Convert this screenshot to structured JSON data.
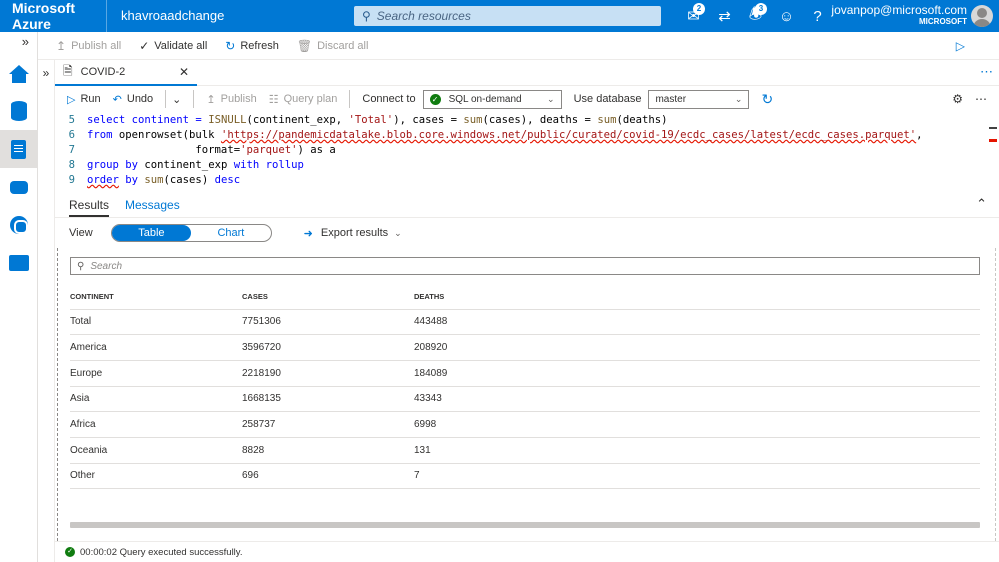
{
  "topbar": {
    "brand": "Microsoft Azure",
    "workspace": "khavroaadchange",
    "search_placeholder": "Search resources",
    "notifications_feedback_count": "2",
    "notifications_count": "3",
    "user_email": "jovanpop@microsoft.com",
    "user_org": "MICROSOFT",
    "accent_color": "#0078d4"
  },
  "commandbar": {
    "publish_all": "Publish all",
    "validate_all": "Validate all",
    "refresh": "Refresh",
    "discard_all": "Discard all"
  },
  "document_tab": {
    "title": "COVID-2"
  },
  "editor_toolbar": {
    "run": "Run",
    "undo": "Undo",
    "publish": "Publish",
    "query_plan": "Query plan",
    "connect_to_label": "Connect to",
    "connect_to_value": "SQL on-demand",
    "use_database_label": "Use database",
    "use_database_value": "master"
  },
  "code": {
    "line_numbers": [
      "5",
      "6",
      "7",
      "8",
      "9"
    ],
    "l5_a": "select continent = ",
    "l5_fn": "ISNULL",
    "l5_b": "(continent_exp, ",
    "l5_str": "'Total'",
    "l5_c": "), cases = ",
    "l5_fn2": "sum",
    "l5_d": "(cases), deaths = ",
    "l5_fn3": "sum",
    "l5_e": "(deaths)",
    "l6_kw": "from",
    "l6_a": " openrowset(bulk ",
    "l6_str": "'https://pandemicdatalake.blob.core.windows.net/public/curated/covid-19/ecdc_cases/latest/ecdc_cases.parquet'",
    "l6_b": ",",
    "l7_a": "                 format=",
    "l7_str": "'parquet'",
    "l7_b": ") as a",
    "l8_kw": "group by",
    "l8_a": " continent_exp ",
    "l8_kw2": "with rollup",
    "l9_kw": "order",
    "l9_kw2": " by",
    "l9_fn": " sum",
    "l9_a": "(cases) ",
    "l9_kw3": "desc"
  },
  "results": {
    "tab_results": "Results",
    "tab_messages": "Messages",
    "view_label": "View",
    "view_table": "Table",
    "view_chart": "Chart",
    "export_results": "Export results",
    "search_placeholder": "Search",
    "columns": [
      "CONTINENT",
      "CASES",
      "DEATHS"
    ],
    "rows": [
      [
        "Total",
        "7751306",
        "443488"
      ],
      [
        "America",
        "3596720",
        "208920"
      ],
      [
        "Europe",
        "2218190",
        "184089"
      ],
      [
        "Asia",
        "1668135",
        "43343"
      ],
      [
        "Africa",
        "258737",
        "6998"
      ],
      [
        "Oceania",
        "8828",
        "131"
      ],
      [
        "Other",
        "696",
        "7"
      ]
    ]
  },
  "status": {
    "message": "00:00:02 Query executed successfully."
  }
}
